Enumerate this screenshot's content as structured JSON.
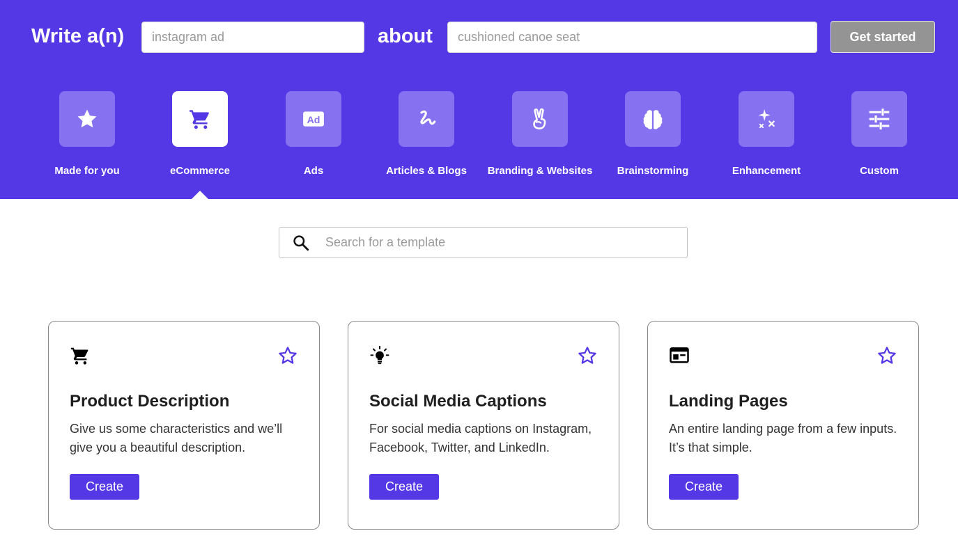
{
  "header": {
    "write_label": "Write a(n)",
    "type_input": {
      "value": "",
      "placeholder": "instagram ad"
    },
    "about_label": "about",
    "topic_input": {
      "value": "",
      "placeholder": "cushioned canoe seat"
    },
    "get_started_label": "Get started"
  },
  "categories": [
    {
      "label": "Made for you",
      "icon": "star-icon",
      "active": false
    },
    {
      "label": "eCommerce",
      "icon": "shopping-cart-icon",
      "active": true
    },
    {
      "label": "Ads",
      "icon": "ad-icon",
      "active": false
    },
    {
      "label": "Articles & Blogs",
      "icon": "squiggle-icon",
      "active": false
    },
    {
      "label": "Branding & Websites",
      "icon": "peace-hand-icon",
      "active": false
    },
    {
      "label": "Brainstorming",
      "icon": "brain-icon",
      "active": false
    },
    {
      "label": "Enhancement",
      "icon": "sparkles-icon",
      "active": false
    },
    {
      "label": "Custom",
      "icon": "sliders-icon",
      "active": false
    }
  ],
  "search": {
    "placeholder": "Search for a template",
    "value": ""
  },
  "cards": [
    {
      "icon": "shopping-cart-icon",
      "title": "Product Description",
      "description": "Give us some characteristics and we’ll give you a beautiful description.",
      "button_label": "Create"
    },
    {
      "icon": "lightbulb-icon",
      "title": "Social Media Captions",
      "description": "For social media captions on Instagram, Facebook, Twitter, and LinkedIn.",
      "button_label": "Create"
    },
    {
      "icon": "web-page-icon",
      "title": "Landing Pages",
      "description": "An entire landing page from a few inputs. It’s that simple.",
      "button_label": "Create"
    }
  ],
  "colors": {
    "brand": "#5438e6",
    "tile": "#8672f0",
    "active_tile": "#ffffff",
    "button_disabled": "#949494",
    "star_outline": "#5438e6"
  }
}
